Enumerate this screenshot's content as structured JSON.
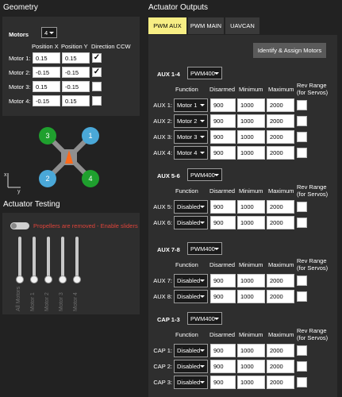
{
  "geometry": {
    "title": "Geometry",
    "motors_label": "Motors",
    "motors_count": "4",
    "col_pos_x": "Position X",
    "col_pos_y": "Position Y",
    "col_dir_ccw": "Direction CCW",
    "motors": [
      {
        "label": "Motor 1:",
        "x": "0.15",
        "y": "0.15",
        "ccw": true
      },
      {
        "label": "Motor 2:",
        "x": "-0.15",
        "y": "-0.15",
        "ccw": true
      },
      {
        "label": "Motor 3:",
        "x": "0.15",
        "y": "-0.15",
        "ccw": false
      },
      {
        "label": "Motor 4:",
        "x": "-0.15",
        "y": "0.15",
        "ccw": false
      }
    ],
    "diagram": {
      "motor_numbers": [
        "3",
        "1",
        "2",
        "4"
      ],
      "axis_x": "x",
      "axis_y": "y",
      "colors": {
        "green": "#1fa02e",
        "blue": "#4aa8d8",
        "frame": "#8f8f8f",
        "arrow": "#ff6a1a"
      }
    }
  },
  "actuator_testing": {
    "title": "Actuator Testing",
    "warning": "Propellers are removed - Enable sliders",
    "warning_color": "#e0443a",
    "sliders": [
      "All Motors",
      "Motor 1",
      "Motor 2",
      "Motor 3",
      "Motor 4"
    ]
  },
  "outputs": {
    "title": "Actuator Outputs",
    "tabs": [
      "PWM AUX",
      "PWM MAIN",
      "UAVCAN"
    ],
    "active_tab": "PWM AUX",
    "identify_button": "Identify & Assign Motors",
    "col_function": "Function",
    "col_disarmed": "Disarmed",
    "col_minimum": "Minimum",
    "col_maximum": "Maximum",
    "col_rev_range": "Rev Range",
    "col_rev_range_sub": "(for Servos)",
    "groups": [
      {
        "title": "AUX 1-4",
        "protocol": "PWM400",
        "rows": [
          {
            "label": "AUX 1:",
            "function": "Motor 1",
            "disarmed": "900",
            "min": "1000",
            "max": "2000"
          },
          {
            "label": "AUX 2:",
            "function": "Motor 2",
            "disarmed": "900",
            "min": "1000",
            "max": "2000"
          },
          {
            "label": "AUX 3:",
            "function": "Motor 3",
            "disarmed": "900",
            "min": "1000",
            "max": "2000"
          },
          {
            "label": "AUX 4:",
            "function": "Motor 4",
            "disarmed": "900",
            "min": "1000",
            "max": "2000"
          }
        ]
      },
      {
        "title": "AUX 5-6",
        "protocol": "PWM400",
        "rows": [
          {
            "label": "AUX 5:",
            "function": "Disabled",
            "disarmed": "900",
            "min": "1000",
            "max": "2000"
          },
          {
            "label": "AUX 6:",
            "function": "Disabled",
            "disarmed": "900",
            "min": "1000",
            "max": "2000"
          }
        ]
      },
      {
        "title": "AUX 7-8",
        "protocol": "PWM400",
        "rows": [
          {
            "label": "AUX 7:",
            "function": "Disabled",
            "disarmed": "900",
            "min": "1000",
            "max": "2000"
          },
          {
            "label": "AUX 8:",
            "function": "Disabled",
            "disarmed": "900",
            "min": "1000",
            "max": "2000"
          }
        ]
      },
      {
        "title": "CAP 1-3",
        "protocol": "PWM400",
        "rows": [
          {
            "label": "CAP 1:",
            "function": "Disabled",
            "disarmed": "900",
            "min": "1000",
            "max": "2000"
          },
          {
            "label": "CAP 2:",
            "function": "Disabled",
            "disarmed": "900",
            "min": "1000",
            "max": "2000"
          },
          {
            "label": "CAP 3:",
            "function": "Disabled",
            "disarmed": "900",
            "min": "1000",
            "max": "2000"
          }
        ]
      }
    ]
  }
}
